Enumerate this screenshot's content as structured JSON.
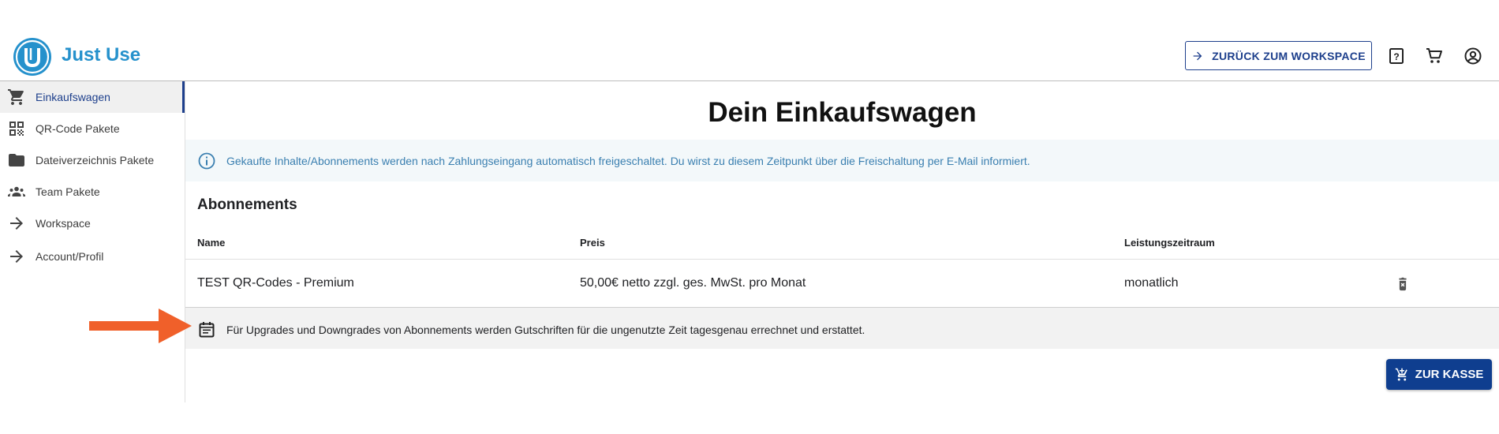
{
  "header": {
    "brand": "Just Use",
    "logo_letter": "U",
    "back_button_label": "ZURÜCK ZUM WORKSPACE",
    "icons": [
      "help-icon",
      "cart-icon",
      "account-circle-icon"
    ]
  },
  "sidebar": {
    "items": [
      {
        "label": "Einkaufswagen",
        "icon": "cart-icon",
        "active": true
      },
      {
        "label": "QR-Code Pakete",
        "icon": "qr-code-icon",
        "active": false
      },
      {
        "label": "Dateiverzeichnis Pakete",
        "icon": "folder-icon",
        "active": false
      },
      {
        "label": "Team Pakete",
        "icon": "team-icon",
        "active": false
      },
      {
        "label": "Workspace",
        "icon": "arrow-right-icon",
        "active": false
      },
      {
        "label": "Account/Profil",
        "icon": "arrow-right-icon",
        "active": false
      }
    ]
  },
  "main": {
    "title": "Dein Einkaufswagen",
    "info_text": "Gekaufte Inhalte/Abonnements werden nach Zahlungseingang automatisch freigeschaltet. Du wirst zu diesem Zeitpunkt über die Freischaltung per E-Mail informiert.",
    "section_title": "Abonnements",
    "table": {
      "headers": [
        "Name",
        "Preis",
        "Leistungszeitraum"
      ],
      "rows": [
        {
          "name": "TEST QR-Codes - Premium",
          "price": "50,00€ netto zzgl. ges. MwSt. pro Monat",
          "period": "monatlich"
        }
      ]
    },
    "note_text": "Für Upgrades und Downgrades von Abonnements werden Gutschriften für die ungenutzte Zeit tagesgenau errechnet und erstattet.",
    "checkout_label": "ZUR KASSE"
  },
  "colors": {
    "brand": "#2591cc",
    "primary": "#0f3e8f",
    "info_text": "#3a7fb0",
    "annotation_arrow": "#f0602a"
  }
}
